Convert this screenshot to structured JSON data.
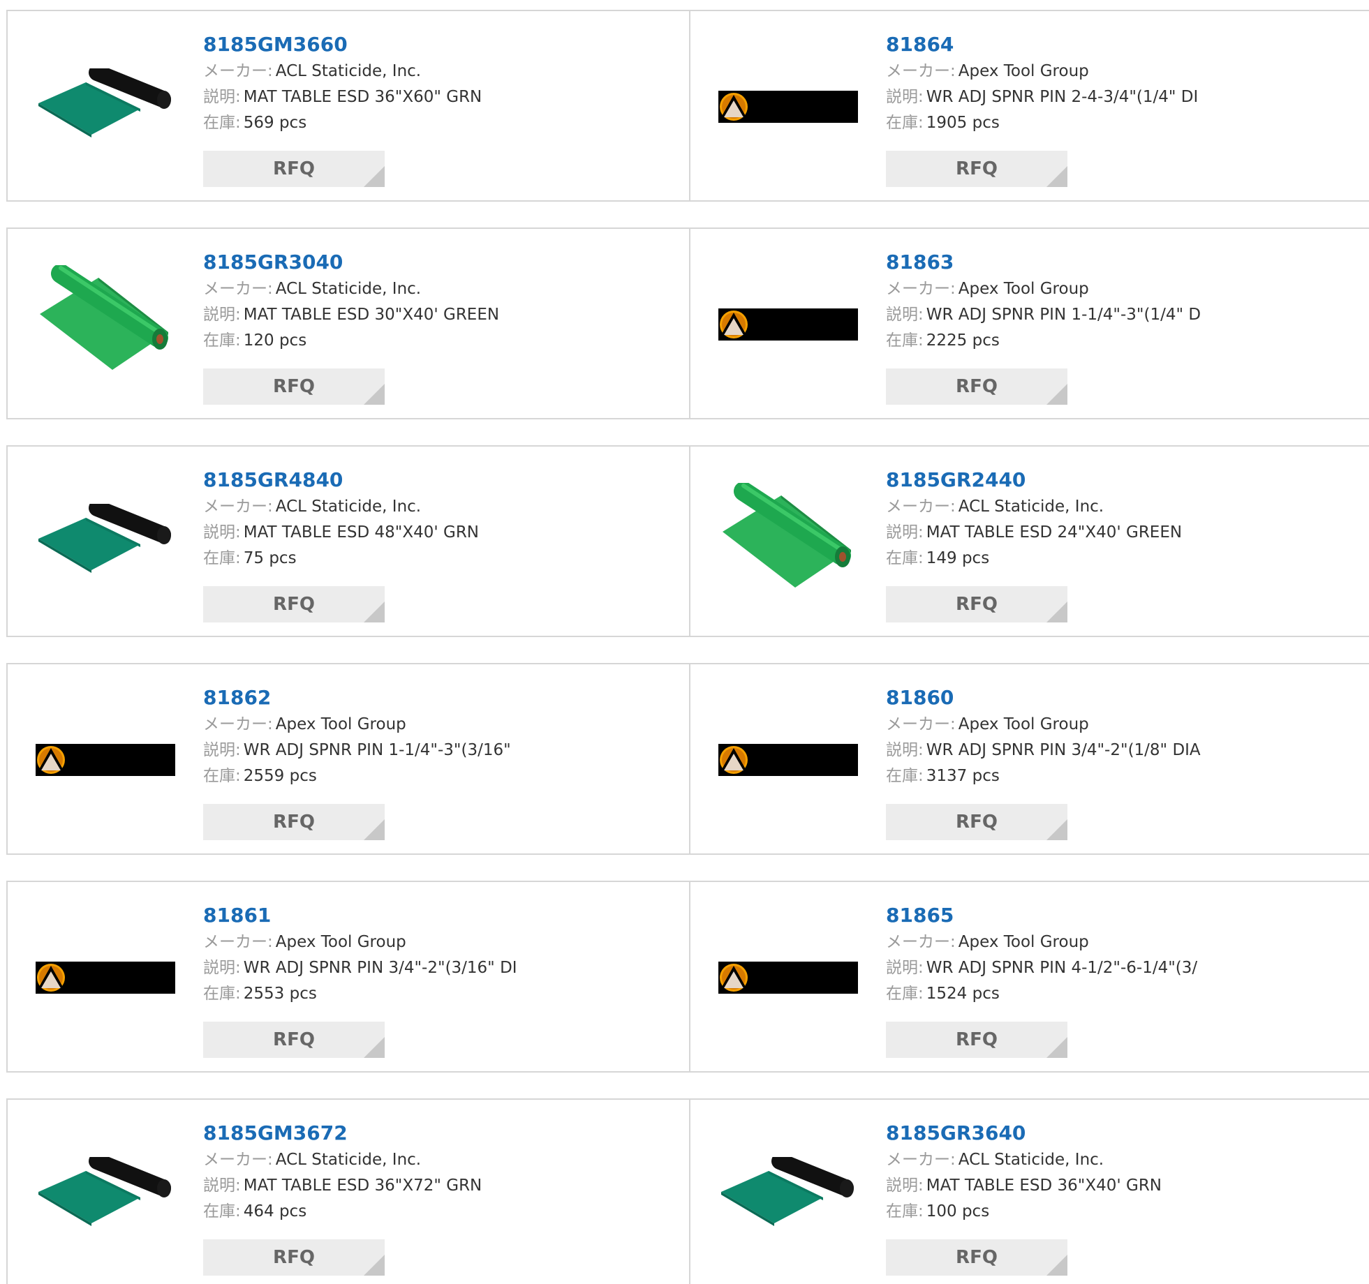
{
  "labels": {
    "manufacturer": "メーカー:",
    "description": "説明:",
    "stock": "在庫:",
    "rfq": "RFQ"
  },
  "colors": {
    "part_number_link": "#1a6bb5",
    "button_bg": "#ececec",
    "border": "#d6d6d6",
    "mat_teal": "#0f8a6e",
    "mat_green": "#1ea84f"
  },
  "products": [
    {
      "pn": "8185GM3660",
      "maker": "ACL Staticide, Inc.",
      "desc": "MAT TABLE ESD 36\"X60\" GRN",
      "stock": "569 pcs",
      "image": "mat-roll-black-teal"
    },
    {
      "pn": "81864",
      "maker": "Apex Tool Group",
      "desc": "WR ADJ SPNR PIN 2-4-3/4\"(1/4\" DI",
      "stock": "1905 pcs",
      "image": "apex-logo-banner"
    },
    {
      "pn": "8185GR3040",
      "maker": "ACL Staticide, Inc.",
      "desc": "MAT TABLE ESD 30\"X40' GREEN",
      "stock": "120 pcs",
      "image": "mat-roll-green"
    },
    {
      "pn": "81863",
      "maker": "Apex Tool Group",
      "desc": "WR ADJ SPNR PIN 1-1/4\"-3\"(1/4\" D",
      "stock": "2225 pcs",
      "image": "apex-logo-banner"
    },
    {
      "pn": "8185GR4840",
      "maker": "ACL Staticide, Inc.",
      "desc": "MAT TABLE ESD 48\"X40' GRN",
      "stock": "75 pcs",
      "image": "mat-roll-black-teal"
    },
    {
      "pn": "8185GR2440",
      "maker": "ACL Staticide, Inc.",
      "desc": "MAT TABLE ESD 24\"X40' GREEN",
      "stock": "149 pcs",
      "image": "mat-roll-green"
    },
    {
      "pn": "81862",
      "maker": "Apex Tool Group",
      "desc": "WR ADJ SPNR PIN 1-1/4\"-3\"(3/16\"",
      "stock": "2559 pcs",
      "image": "apex-logo-banner"
    },
    {
      "pn": "81860",
      "maker": "Apex Tool Group",
      "desc": "WR ADJ SPNR PIN 3/4\"-2\"(1/8\" DIA",
      "stock": "3137 pcs",
      "image": "apex-logo-banner"
    },
    {
      "pn": "81861",
      "maker": "Apex Tool Group",
      "desc": "WR ADJ SPNR PIN 3/4\"-2\"(3/16\" DI",
      "stock": "2553 pcs",
      "image": "apex-logo-banner"
    },
    {
      "pn": "81865",
      "maker": "Apex Tool Group",
      "desc": "WR ADJ SPNR PIN 4-1/2\"-6-1/4\"(3/",
      "stock": "1524 pcs",
      "image": "apex-logo-banner"
    },
    {
      "pn": "8185GM3672",
      "maker": "ACL Staticide, Inc.",
      "desc": "MAT TABLE ESD 36\"X72\" GRN",
      "stock": "464 pcs",
      "image": "mat-roll-black-teal"
    },
    {
      "pn": "8185GR3640",
      "maker": "ACL Staticide, Inc.",
      "desc": "MAT TABLE ESD 36\"X40' GRN",
      "stock": "100 pcs",
      "image": "mat-roll-black-teal"
    }
  ]
}
